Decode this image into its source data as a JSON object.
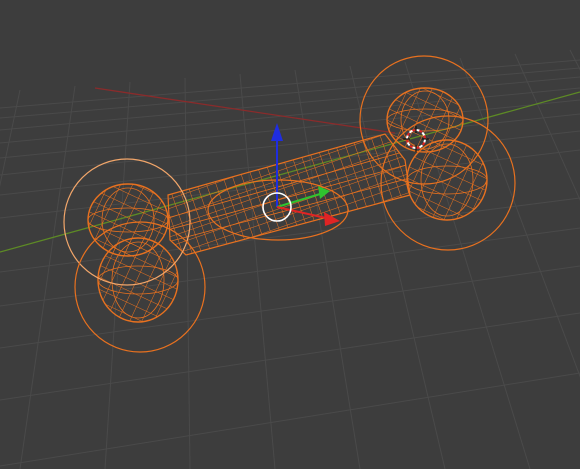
{
  "viewport": {
    "background": "#3d3d3d",
    "grid_color": "#4a4a4a",
    "x_axis_color": "#8a2b2b",
    "y_axis_color": "#5d8a25"
  },
  "selection": {
    "color": "#e8711f",
    "active_color": "#f2a66a",
    "mesh": "bone-metaball",
    "elements": [
      "bone-shaft",
      "left-knob-upper",
      "left-knob-lower",
      "right-knob-upper",
      "right-knob-lower"
    ]
  },
  "gizmo": {
    "z_color": "#1f2de0",
    "y_color": "#2fc42f",
    "x_color": "#e02424",
    "center_ring_color": "#ffffff"
  },
  "cursor_3d": {
    "icon": "crosshair-icon"
  }
}
